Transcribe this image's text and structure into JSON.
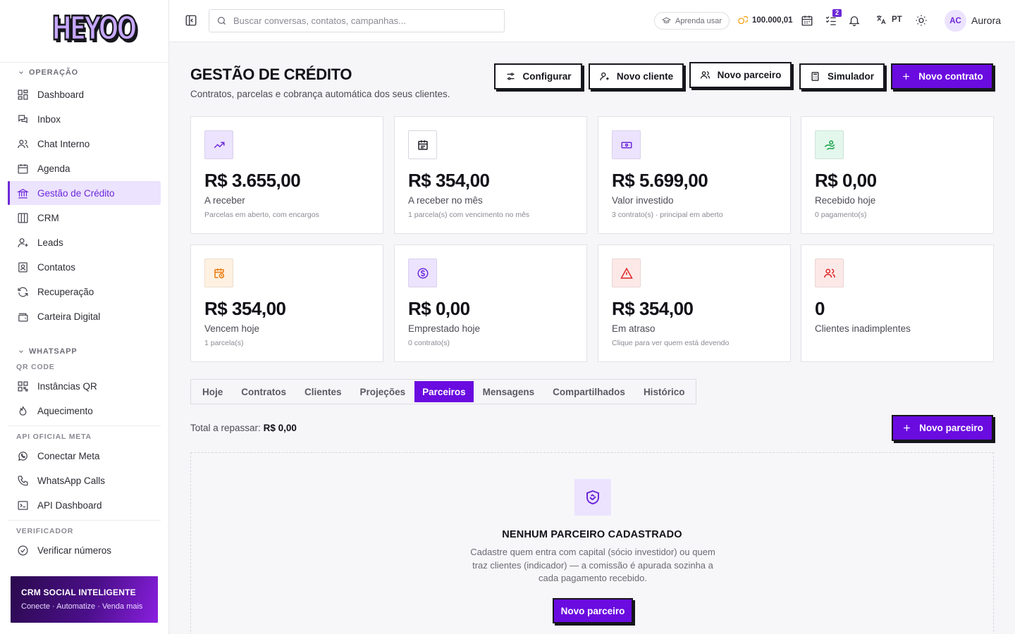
{
  "brand": {
    "logo_text": "HEYOO",
    "accent": "#6a0be0",
    "accent_soft": "#ece3ff"
  },
  "sidebar": {
    "sections": {
      "operacao": "OPERAÇÃO",
      "whatsapp": "WHATSAPP",
      "qr_code": "QR CODE",
      "api_meta": "API OFICIAL META",
      "verificador": "VERIFICADOR"
    },
    "items": {
      "dashboard": "Dashboard",
      "inbox": "Inbox",
      "chat_interno": "Chat Interno",
      "agenda": "Agenda",
      "gestao_credito": "Gestão de Crédito",
      "crm": "CRM",
      "leads": "Leads",
      "contatos": "Contatos",
      "recuperacao": "Recuperação",
      "carteira_digital": "Carteira Digital",
      "instancias_qr": "Instâncias QR",
      "aquecimento": "Aquecimento",
      "conectar_meta": "Conectar Meta",
      "whatsapp_calls": "WhatsApp Calls",
      "api_dashboard": "API Dashboard",
      "verificar_numeros": "Verificar números"
    },
    "promo": {
      "title": "CRM SOCIAL INTELIGENTE",
      "subtitle": "Conecte · Automatize · Venda mais"
    }
  },
  "topbar": {
    "search_placeholder": "Buscar conversas, contatos, campanhas...",
    "learn": "Aprenda usar",
    "coins": "100.000,01",
    "tasks_badge": "2",
    "language": "PT",
    "avatar_initials": "AC",
    "username": "Aurora"
  },
  "page": {
    "title": "GESTÃO DE CRÉDITO",
    "subtitle": "Contratos, parcelas e cobrança automática dos seus clientes.",
    "actions": {
      "configurar": "Configurar",
      "novo_cliente": "Novo cliente",
      "novo_parceiro": "Novo parceiro",
      "simulador": "Simulador",
      "novo_contrato": "Novo contrato"
    }
  },
  "stats": [
    {
      "value": "R$ 3.655,00",
      "label": "A receber",
      "hint": "Parcelas em aberto, com encargos",
      "icon": "trending-up-icon",
      "bg": "#ece3ff",
      "fg": "#6d28d9"
    },
    {
      "value": "R$ 354,00",
      "label": "A receber no mês",
      "hint": "1 parcela(s) com vencimento no mês",
      "icon": "calendar-icon",
      "bg": "#ffffff",
      "fg": "#1f1f28"
    },
    {
      "value": "R$ 5.699,00",
      "label": "Valor investido",
      "hint": "3 contrato(s) · principal em aberto",
      "icon": "banknote-icon",
      "bg": "#ece3ff",
      "fg": "#6d28d9"
    },
    {
      "value": "R$ 0,00",
      "label": "Recebido hoje",
      "hint": "0 pagamento(s)",
      "icon": "hand-coins-icon",
      "bg": "#e3f7ec",
      "fg": "#16a34a"
    },
    {
      "value": "R$ 354,00",
      "label": "Vencem hoje",
      "hint": "1 parcela(s)",
      "icon": "calendar-clock-icon",
      "bg": "#fff1e2",
      "fg": "#ea7a0c"
    },
    {
      "value": "R$ 0,00",
      "label": "Emprestado hoje",
      "hint": "0 contrato(s)",
      "icon": "dollar-circle-icon",
      "bg": "#ece3ff",
      "fg": "#6d28d9"
    },
    {
      "value": "R$ 354,00",
      "label": "Em atraso",
      "hint": "Clique para ver quem está devendo",
      "icon": "alert-triangle-icon",
      "bg": "#fde8e8",
      "fg": "#dc2626"
    },
    {
      "value": "0",
      "label": "Clientes inadimplentes",
      "hint": "",
      "icon": "users-icon",
      "bg": "#fde8e8",
      "fg": "#dc2626"
    }
  ],
  "tabs": [
    "Hoje",
    "Contratos",
    "Clientes",
    "Projeções",
    "Parceiros",
    "Mensagens",
    "Compartilhados",
    "Histórico"
  ],
  "active_tab": "Parceiros",
  "partners": {
    "total_label": "Total a repassar:",
    "total_value": "R$ 0,00",
    "add_button": "Novo parceiro",
    "empty_title": "NENHUM PARCEIRO CADASTRADO",
    "empty_desc": "Cadastre quem entra com capital (sócio investidor) ou quem traz clientes (indicador) — a comissão é apurada sozinha a cada pagamento recebido.",
    "empty_button": "Novo parceiro"
  }
}
